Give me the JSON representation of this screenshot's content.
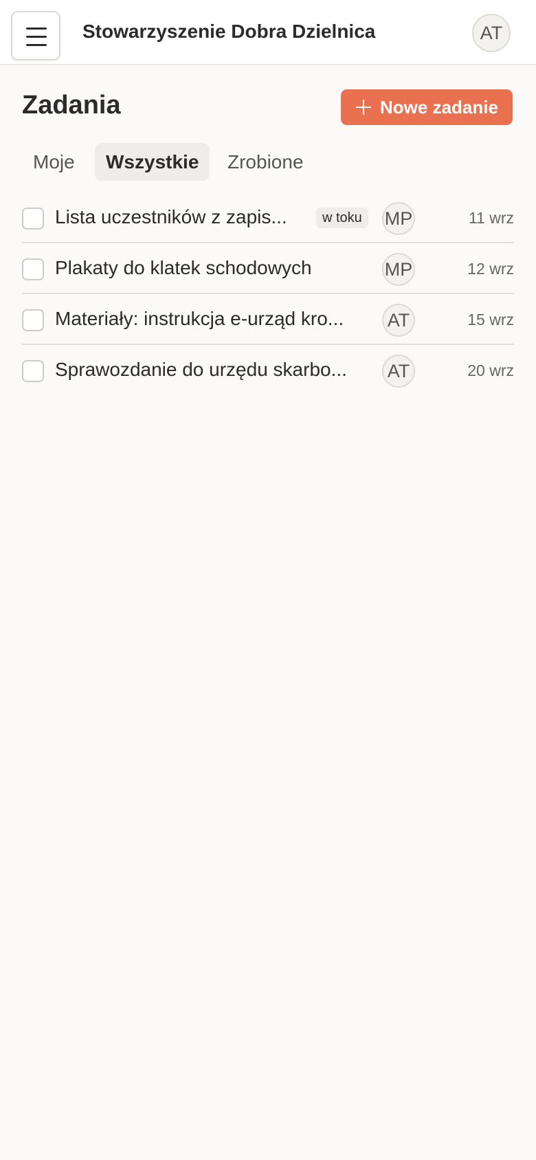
{
  "header": {
    "org_name": "Stowarzyszenie Dobra Dzielnica",
    "user_initials": "AT"
  },
  "page": {
    "title": "Zadania",
    "new_task_label": "Nowe zadanie"
  },
  "tabs": [
    {
      "label": "Moje",
      "active": false
    },
    {
      "label": "Wszystkie",
      "active": true
    },
    {
      "label": "Zrobione",
      "active": false
    }
  ],
  "tasks": [
    {
      "title": "Lista uczestników z zapis...",
      "status": "w toku",
      "assignee": "MP",
      "due": "11 wrz",
      "done": false
    },
    {
      "title": "Plakaty do klatek schodowych",
      "status": "",
      "assignee": "MP",
      "due": "12 wrz",
      "done": false
    },
    {
      "title": "Materiały: instrukcja e-urząd kro...",
      "status": "",
      "assignee": "AT",
      "due": "15 wrz",
      "done": false
    },
    {
      "title": "Sprawozdanie do urzędu skarbo...",
      "status": "",
      "assignee": "AT",
      "due": "20 wrz",
      "done": false
    }
  ],
  "colors": {
    "accent": "#ea7150",
    "background": "#fbfaf8"
  },
  "icons": {
    "menu": "hamburger-menu-icon",
    "new_task": "plus-icon"
  }
}
